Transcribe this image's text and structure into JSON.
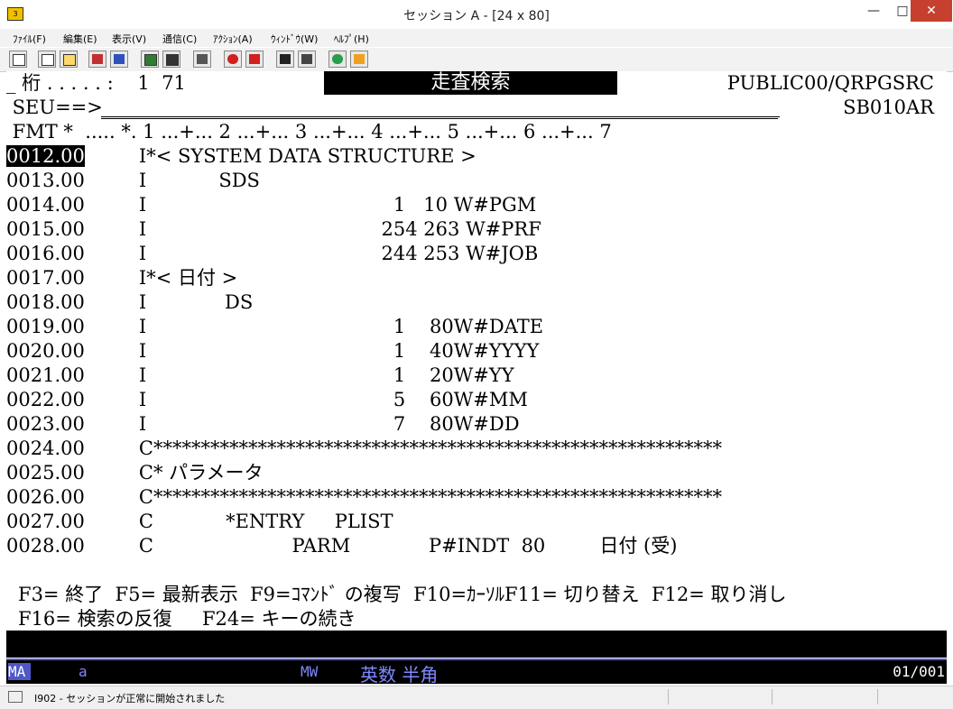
{
  "window": {
    "title": "セッション A - [24 x 80]",
    "min": "—",
    "max": "□",
    "close": "✕"
  },
  "menu": [
    "ﾌｧｲﾙ(F)",
    "編集(E)",
    "表示(V)",
    "通信(C)",
    "ｱｸｼｮﾝ(A)",
    "ｳｨﾝﾄﾞｳ(W)",
    "ﾍﾙﾌﾟ(H)"
  ],
  "header": {
    "left": "_ 桁 . . . . . :    1  71",
    "title": "走査検索",
    "library": "PUBLIC00/QRPGSRC",
    "seu_prompt": " SEU==>",
    "member": "SB010AR",
    "fmt_ruler": " FMT *  ..... *. 1 ...+... 2 ...+... 3 ...+... 4 ...+... 5 ...+... 6 ...+... 7"
  },
  "lines": [
    {
      "seq": "0012.00",
      "text": "         I*< SYSTEM DATA STRUCTURE >"
    },
    {
      "seq": "0013.00",
      "text": "         I            SDS"
    },
    {
      "seq": "0014.00",
      "text": "         I                                         1   10 W#PGM"
    },
    {
      "seq": "0015.00",
      "text": "         I                                       254 263 W#PRF"
    },
    {
      "seq": "0016.00",
      "text": "         I                                       244 253 W#JOB"
    },
    {
      "seq": "0017.00",
      "text": "         I*< 日付 >"
    },
    {
      "seq": "0018.00",
      "text": "         I             DS"
    },
    {
      "seq": "0019.00",
      "text": "         I                                         1    80W#DATE"
    },
    {
      "seq": "0020.00",
      "text": "         I                                         1    40W#YYYY"
    },
    {
      "seq": "0021.00",
      "text": "         I                                         1    20W#YY"
    },
    {
      "seq": "0022.00",
      "text": "         I                                         5    60W#MM"
    },
    {
      "seq": "0023.00",
      "text": "         I                                         7    80W#DD"
    },
    {
      "seq": "0024.00",
      "text": "         C************************************************************"
    },
    {
      "seq": "0025.00",
      "text": "         C* パラメータ"
    },
    {
      "seq": "0026.00",
      "text": "         C************************************************************"
    },
    {
      "seq": "0027.00",
      "text": "         C            *ENTRY     PLIST"
    },
    {
      "seq": "0028.00",
      "text": "         C                       PARM             P#INDT  80         日付 (受)"
    }
  ],
  "fkeys": {
    "line1": "F3= 終了  F5= 最新表示  F9=ｺﾏﾝﾄﾞ の複写  F10=ｶｰｿﾙF11= 切り替え  F12= 取り消し",
    "line2": "F16= 検索の反復     F24= キーの続き"
  },
  "oia": {
    "mode": "MA",
    "a": "a",
    "mw": "MW",
    "kana": "英数 半角",
    "position": "01/001"
  },
  "status": {
    "message": "I902 - セッションが正常に開始されました"
  }
}
